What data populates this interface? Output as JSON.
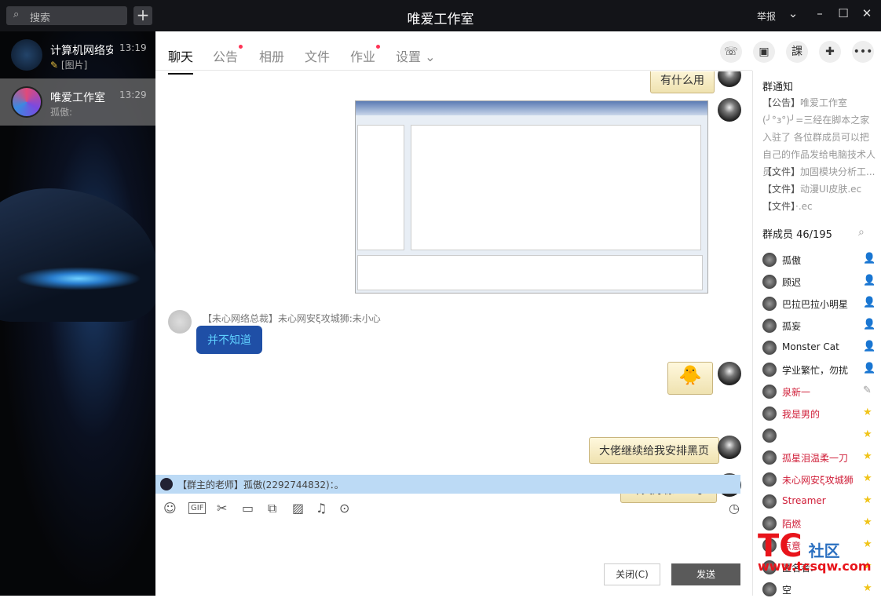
{
  "titlebar": {
    "search_placeholder": "搜索",
    "title": "唯爱工作室",
    "report": "举报"
  },
  "conversations": [
    {
      "name": "计算机网络安",
      "time": "13:19",
      "preview": "[图片]"
    },
    {
      "name": "唯爱工作室",
      "time": "13:29",
      "preview": "孤傲:"
    }
  ],
  "tabs": [
    {
      "label": "聊天",
      "active": true
    },
    {
      "label": "公告",
      "dot": true
    },
    {
      "label": "相册"
    },
    {
      "label": "文件"
    },
    {
      "label": "作业",
      "dot": true
    },
    {
      "label": "设置 ⌄"
    }
  ],
  "messages": {
    "m1": "有什么用",
    "sender": "【未心网络总裁】未心网安ξ攻城狮:未小心",
    "m2": "并不知道",
    "m3": "大佬继续给我安排黑页",
    "m4": "昨天好像404了"
  },
  "notice_bar": "【群主的老师】孤傲(2292744832)：。",
  "buttons": {
    "close": "关闭(C)",
    "send": "发送"
  },
  "right": {
    "notice_title": "群通知",
    "notices": [
      {
        "tag": "【公告】",
        "text": "唯爱工作室(╯°з°)╯=三经在脚本之家入驻了 各位群成员可以把自己的作品发给电脑技术人员..."
      },
      {
        "tag": "【文件】",
        "text": "加固模块分析工..."
      },
      {
        "tag": "【文件】",
        "text": "动漫UI皮肤.ec"
      },
      {
        "tag": "【文件】",
        "text": "·.ec"
      }
    ],
    "members_title": "群成员 46/195",
    "members": [
      {
        "name": "孤傲",
        "role": "owner"
      },
      {
        "name": "顾迟",
        "role": "admin"
      },
      {
        "name": "巴拉巴拉小明星",
        "role": "admin"
      },
      {
        "name": "孤妄",
        "role": "admin"
      },
      {
        "name": "Monster Cat",
        "role": "admin"
      },
      {
        "name": "学业繁忙，勿扰",
        "role": "admin"
      },
      {
        "name": "泉新一",
        "role": "edit",
        "red": true
      },
      {
        "name": "我是男的",
        "role": "star",
        "red": true
      },
      {
        "name": "",
        "role": "star"
      },
      {
        "name": "孤星泪温柔一刀",
        "role": "star",
        "red": true
      },
      {
        "name": "未心网安ξ攻城狮",
        "role": "star",
        "red": true
      },
      {
        "name": "Streamer",
        "role": "star",
        "red": true
      },
      {
        "name": "陌燃",
        "role": "star",
        "red": true
      },
      {
        "name": "凉意",
        "role": "star",
        "red": true
      },
      {
        "name": "匿名者.",
        "role": "star"
      },
      {
        "name": "空",
        "role": "star"
      }
    ]
  },
  "watermark": {
    "logo": "TC",
    "text": "社区",
    "url": "www.tcsqw.com"
  },
  "colors": {
    "titlebar": "#131418",
    "notice_bar": "#bcdaf5",
    "bubble_blue": "#1f4fa6",
    "red_name": "#d0203a"
  }
}
